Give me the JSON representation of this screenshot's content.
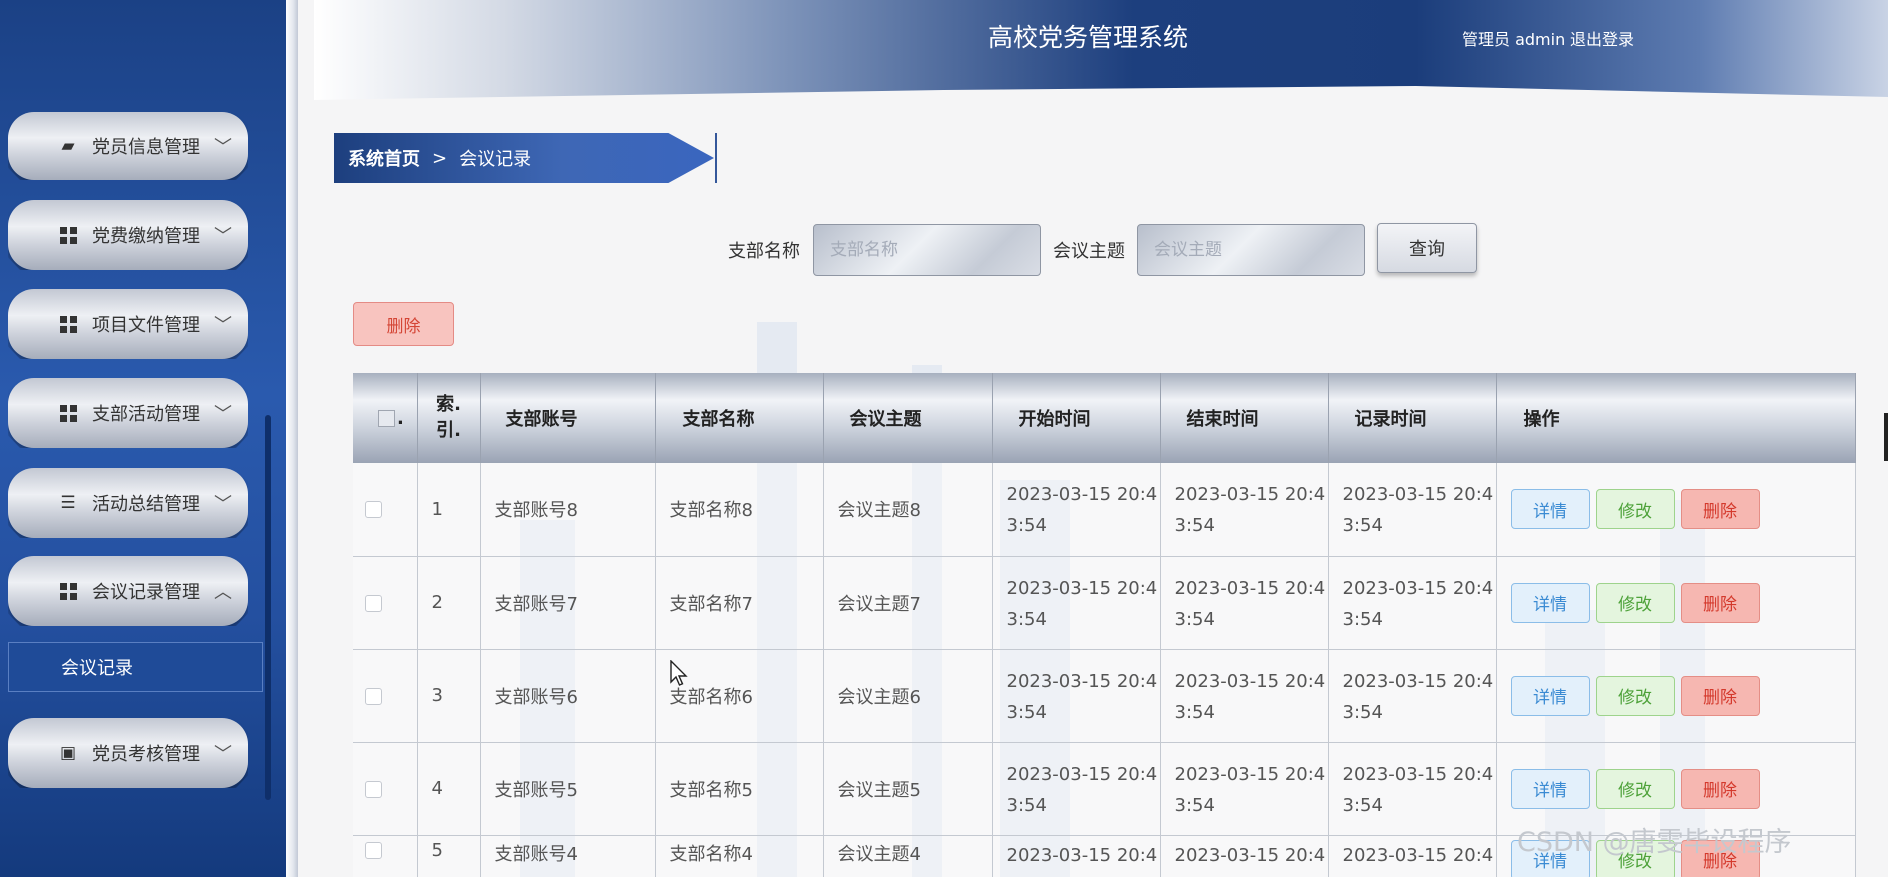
{
  "app": {
    "title": "高校党务管理系统"
  },
  "header": {
    "user": "管理员 admin",
    "logout": "退出登录"
  },
  "sidebar": {
    "items": [
      {
        "label": "党员信息管理",
        "icon": "wallet-icon",
        "arrow": "﹀"
      },
      {
        "label": "党费缴纳管理",
        "icon": "grid-icon",
        "arrow": "﹀"
      },
      {
        "label": "项目文件管理",
        "icon": "grid-icon",
        "arrow": "﹀"
      },
      {
        "label": "支部活动管理",
        "icon": "grid-icon",
        "arrow": "﹀"
      },
      {
        "label": "活动总结管理",
        "icon": "sliders-icon",
        "arrow": "﹀"
      },
      {
        "label": "会议记录管理",
        "icon": "grid-icon",
        "arrow": "︿"
      },
      {
        "label": "党员考核管理",
        "icon": "clipboard-icon",
        "arrow": "﹀"
      }
    ],
    "submenu": {
      "label": "会议记录"
    }
  },
  "breadcrumb": {
    "home": "系统首页",
    "separator": ">",
    "current": "会议记录"
  },
  "search": {
    "branch_label": "支部名称",
    "branch_placeholder": "支部名称",
    "topic_label": "会议主题",
    "topic_placeholder": "会议主题",
    "query_button": "查询"
  },
  "actions": {
    "bulk_delete": "删除"
  },
  "table": {
    "headers": {
      "index_line1": "索.",
      "index_line2": "引.",
      "account": "支部账号",
      "name": "支部名称",
      "topic": "会议主题",
      "start": "开始时间",
      "end": "结束时间",
      "record": "记录时间",
      "ops": "操作"
    },
    "buttons": {
      "detail": "详情",
      "edit": "修改",
      "delete": "删除"
    },
    "rows": [
      {
        "index": "1",
        "account": "支部账号8",
        "name": "支部名称8",
        "topic": "会议主题8",
        "start1": "2023-03-15 20:4",
        "start2": "3:54",
        "end1": "2023-03-15 20:4",
        "end2": "3:54",
        "rec1": "2023-03-15 20:4",
        "rec2": "3:54"
      },
      {
        "index": "2",
        "account": "支部账号7",
        "name": "支部名称7",
        "topic": "会议主题7",
        "start1": "2023-03-15 20:4",
        "start2": "3:54",
        "end1": "2023-03-15 20:4",
        "end2": "3:54",
        "rec1": "2023-03-15 20:4",
        "rec2": "3:54"
      },
      {
        "index": "3",
        "account": "支部账号6",
        "name": "支部名称6",
        "topic": "会议主题6",
        "start1": "2023-03-15 20:4",
        "start2": "3:54",
        "end1": "2023-03-15 20:4",
        "end2": "3:54",
        "rec1": "2023-03-15 20:4",
        "rec2": "3:54"
      },
      {
        "index": "4",
        "account": "支部账号5",
        "name": "支部名称5",
        "topic": "会议主题5",
        "start1": "2023-03-15 20:4",
        "start2": "3:54",
        "end1": "2023-03-15 20:4",
        "end2": "3:54",
        "rec1": "2023-03-15 20:4",
        "rec2": "3:54"
      },
      {
        "index": "5",
        "account": "支部账号4",
        "name": "支部名称4",
        "topic": "会议主题4",
        "start1": "2023-03-15 20:4",
        "start2": "",
        "end1": "2023-03-15 20:4",
        "end2": "",
        "rec1": "2023-03-15 20:4",
        "rec2": ""
      }
    ]
  },
  "watermark": "CSDN @唐雯毕设程序"
}
